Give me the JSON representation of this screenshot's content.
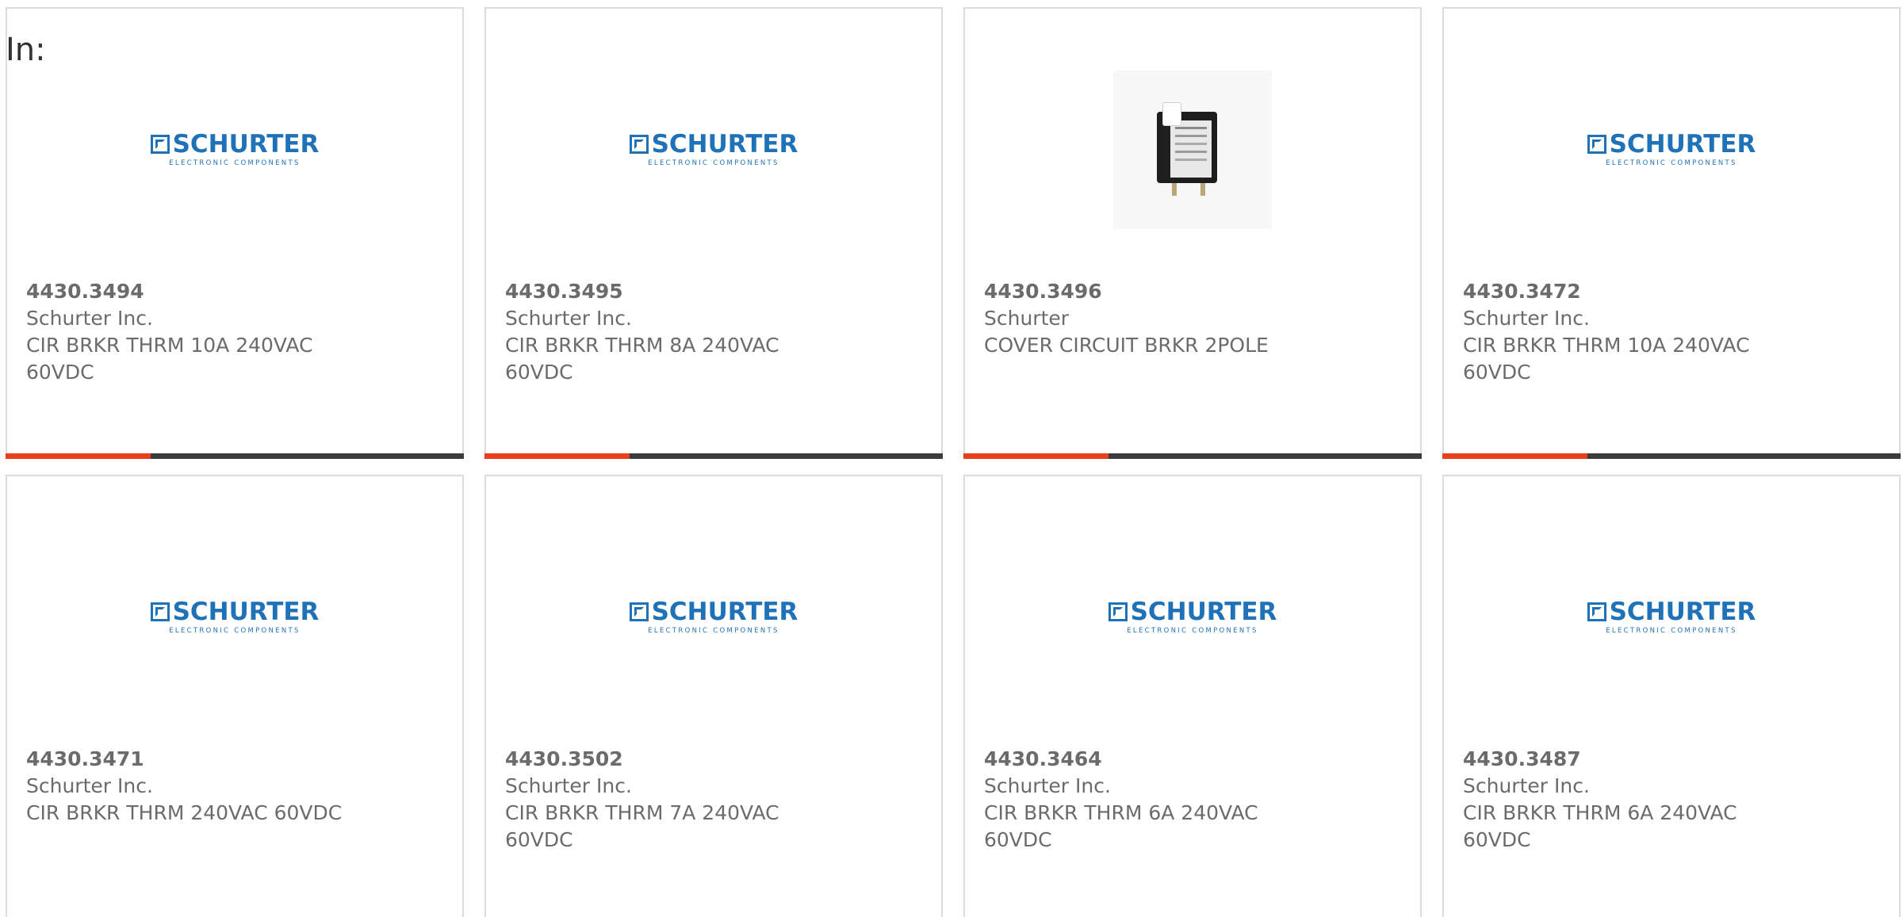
{
  "page": {
    "filter_label": "In:"
  },
  "logo": {
    "word": "SCHURTER",
    "tagline": "ELECTRONIC COMPONENTS"
  },
  "colors": {
    "logo_blue": "#1f72b8",
    "accent_orange": "#e8401c",
    "bar_dark": "#3c3c3c",
    "text_gray": "#6b6b6b",
    "card_border": "#dcdcdc"
  },
  "products": [
    {
      "part_number": "4430.3494",
      "manufacturer": "Schurter Inc.",
      "description": "CIR BRKR THRM 10A 240VAC 60VDC",
      "image": "schurter-logo"
    },
    {
      "part_number": "4430.3495",
      "manufacturer": "Schurter Inc.",
      "description": "CIR BRKR THRM 8A 240VAC 60VDC",
      "image": "schurter-logo"
    },
    {
      "part_number": "4430.3496",
      "manufacturer": "Schurter",
      "description": "COVER CIRCUIT BRKR 2POLE",
      "image": "breaker-photo"
    },
    {
      "part_number": "4430.3472",
      "manufacturer": "Schurter Inc.",
      "description": "CIR BRKR THRM 10A 240VAC 60VDC",
      "image": "schurter-logo"
    },
    {
      "part_number": "4430.3471",
      "manufacturer": "Schurter Inc.",
      "description": "CIR BRKR THRM 240VAC 60VDC",
      "image": "schurter-logo"
    },
    {
      "part_number": "4430.3502",
      "manufacturer": "Schurter Inc.",
      "description": "CIR BRKR THRM 7A 240VAC 60VDC",
      "image": "schurter-logo"
    },
    {
      "part_number": "4430.3464",
      "manufacturer": "Schurter Inc.",
      "description": "CIR BRKR THRM 6A 240VAC 60VDC",
      "image": "schurter-logo"
    },
    {
      "part_number": "4430.3487",
      "manufacturer": "Schurter Inc.",
      "description": "CIR BRKR THRM 6A 240VAC 60VDC",
      "image": "schurter-logo"
    }
  ]
}
